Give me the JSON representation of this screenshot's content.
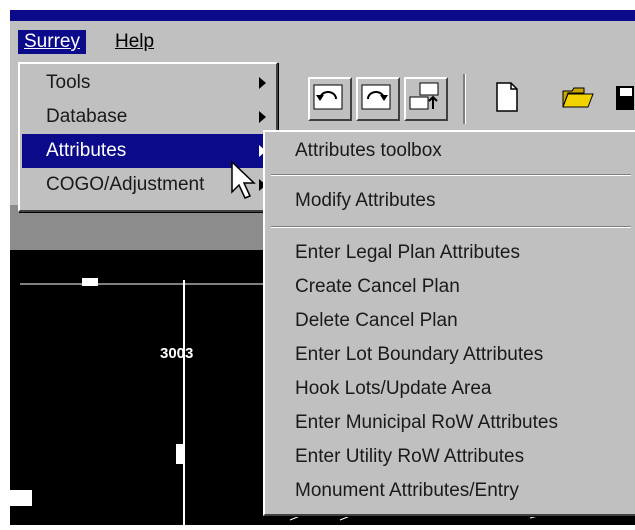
{
  "menubar": {
    "items": [
      {
        "label": "Surrey"
      },
      {
        "label": "Help"
      }
    ]
  },
  "surrey_menu": {
    "items": [
      {
        "label": "Tools"
      },
      {
        "label": "Database"
      },
      {
        "label": "Attributes"
      },
      {
        "label": "COGO/Adjustment"
      }
    ]
  },
  "attributes_submenu": {
    "items": [
      "Attributes toolbox",
      "Modify Attributes",
      "Enter Legal Plan Attributes",
      "Create Cancel Plan",
      "Delete Cancel Plan",
      "Enter Lot Boundary Attributes",
      "Hook Lots/Update Area",
      "Enter Municipal RoW Attributes",
      "Enter Utility RoW Attributes",
      "Monument Attributes/Entry"
    ]
  },
  "toolbar_icons": [
    "undo-icon",
    "redo-icon",
    "arrange-icon",
    "new-document-icon",
    "open-folder-icon",
    "save-icon"
  ],
  "drawing_labels": {
    "lot_number": "3003"
  },
  "colors": {
    "menu_highlight": "#0a0a8a",
    "menu_bg": "#c0c0c0",
    "canvas_bg": "#000000"
  }
}
